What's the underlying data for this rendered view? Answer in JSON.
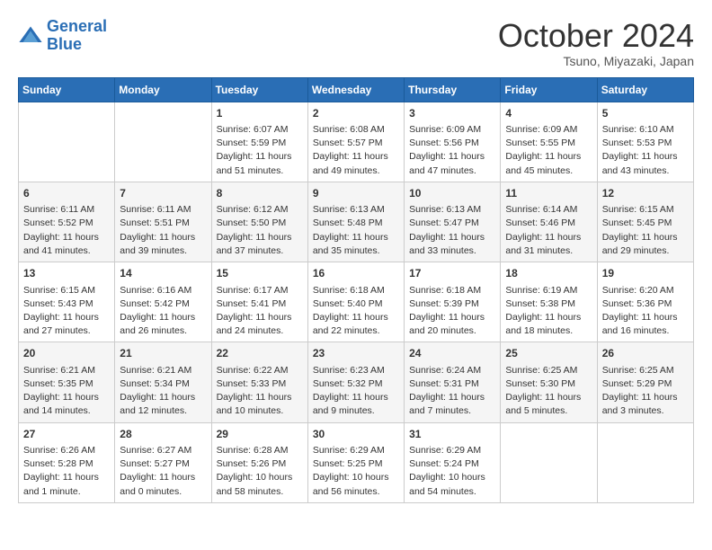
{
  "logo": {
    "line1": "General",
    "line2": "Blue"
  },
  "title": "October 2024",
  "subtitle": "Tsuno, Miyazaki, Japan",
  "days_of_week": [
    "Sunday",
    "Monday",
    "Tuesday",
    "Wednesday",
    "Thursday",
    "Friday",
    "Saturday"
  ],
  "weeks": [
    [
      {
        "day": "",
        "sunrise": "",
        "sunset": "",
        "daylight": ""
      },
      {
        "day": "",
        "sunrise": "",
        "sunset": "",
        "daylight": ""
      },
      {
        "day": "1",
        "sunrise": "Sunrise: 6:07 AM",
        "sunset": "Sunset: 5:59 PM",
        "daylight": "Daylight: 11 hours and 51 minutes."
      },
      {
        "day": "2",
        "sunrise": "Sunrise: 6:08 AM",
        "sunset": "Sunset: 5:57 PM",
        "daylight": "Daylight: 11 hours and 49 minutes."
      },
      {
        "day": "3",
        "sunrise": "Sunrise: 6:09 AM",
        "sunset": "Sunset: 5:56 PM",
        "daylight": "Daylight: 11 hours and 47 minutes."
      },
      {
        "day": "4",
        "sunrise": "Sunrise: 6:09 AM",
        "sunset": "Sunset: 5:55 PM",
        "daylight": "Daylight: 11 hours and 45 minutes."
      },
      {
        "day": "5",
        "sunrise": "Sunrise: 6:10 AM",
        "sunset": "Sunset: 5:53 PM",
        "daylight": "Daylight: 11 hours and 43 minutes."
      }
    ],
    [
      {
        "day": "6",
        "sunrise": "Sunrise: 6:11 AM",
        "sunset": "Sunset: 5:52 PM",
        "daylight": "Daylight: 11 hours and 41 minutes."
      },
      {
        "day": "7",
        "sunrise": "Sunrise: 6:11 AM",
        "sunset": "Sunset: 5:51 PM",
        "daylight": "Daylight: 11 hours and 39 minutes."
      },
      {
        "day": "8",
        "sunrise": "Sunrise: 6:12 AM",
        "sunset": "Sunset: 5:50 PM",
        "daylight": "Daylight: 11 hours and 37 minutes."
      },
      {
        "day": "9",
        "sunrise": "Sunrise: 6:13 AM",
        "sunset": "Sunset: 5:48 PM",
        "daylight": "Daylight: 11 hours and 35 minutes."
      },
      {
        "day": "10",
        "sunrise": "Sunrise: 6:13 AM",
        "sunset": "Sunset: 5:47 PM",
        "daylight": "Daylight: 11 hours and 33 minutes."
      },
      {
        "day": "11",
        "sunrise": "Sunrise: 6:14 AM",
        "sunset": "Sunset: 5:46 PM",
        "daylight": "Daylight: 11 hours and 31 minutes."
      },
      {
        "day": "12",
        "sunrise": "Sunrise: 6:15 AM",
        "sunset": "Sunset: 5:45 PM",
        "daylight": "Daylight: 11 hours and 29 minutes."
      }
    ],
    [
      {
        "day": "13",
        "sunrise": "Sunrise: 6:15 AM",
        "sunset": "Sunset: 5:43 PM",
        "daylight": "Daylight: 11 hours and 27 minutes."
      },
      {
        "day": "14",
        "sunrise": "Sunrise: 6:16 AM",
        "sunset": "Sunset: 5:42 PM",
        "daylight": "Daylight: 11 hours and 26 minutes."
      },
      {
        "day": "15",
        "sunrise": "Sunrise: 6:17 AM",
        "sunset": "Sunset: 5:41 PM",
        "daylight": "Daylight: 11 hours and 24 minutes."
      },
      {
        "day": "16",
        "sunrise": "Sunrise: 6:18 AM",
        "sunset": "Sunset: 5:40 PM",
        "daylight": "Daylight: 11 hours and 22 minutes."
      },
      {
        "day": "17",
        "sunrise": "Sunrise: 6:18 AM",
        "sunset": "Sunset: 5:39 PM",
        "daylight": "Daylight: 11 hours and 20 minutes."
      },
      {
        "day": "18",
        "sunrise": "Sunrise: 6:19 AM",
        "sunset": "Sunset: 5:38 PM",
        "daylight": "Daylight: 11 hours and 18 minutes."
      },
      {
        "day": "19",
        "sunrise": "Sunrise: 6:20 AM",
        "sunset": "Sunset: 5:36 PM",
        "daylight": "Daylight: 11 hours and 16 minutes."
      }
    ],
    [
      {
        "day": "20",
        "sunrise": "Sunrise: 6:21 AM",
        "sunset": "Sunset: 5:35 PM",
        "daylight": "Daylight: 11 hours and 14 minutes."
      },
      {
        "day": "21",
        "sunrise": "Sunrise: 6:21 AM",
        "sunset": "Sunset: 5:34 PM",
        "daylight": "Daylight: 11 hours and 12 minutes."
      },
      {
        "day": "22",
        "sunrise": "Sunrise: 6:22 AM",
        "sunset": "Sunset: 5:33 PM",
        "daylight": "Daylight: 11 hours and 10 minutes."
      },
      {
        "day": "23",
        "sunrise": "Sunrise: 6:23 AM",
        "sunset": "Sunset: 5:32 PM",
        "daylight": "Daylight: 11 hours and 9 minutes."
      },
      {
        "day": "24",
        "sunrise": "Sunrise: 6:24 AM",
        "sunset": "Sunset: 5:31 PM",
        "daylight": "Daylight: 11 hours and 7 minutes."
      },
      {
        "day": "25",
        "sunrise": "Sunrise: 6:25 AM",
        "sunset": "Sunset: 5:30 PM",
        "daylight": "Daylight: 11 hours and 5 minutes."
      },
      {
        "day": "26",
        "sunrise": "Sunrise: 6:25 AM",
        "sunset": "Sunset: 5:29 PM",
        "daylight": "Daylight: 11 hours and 3 minutes."
      }
    ],
    [
      {
        "day": "27",
        "sunrise": "Sunrise: 6:26 AM",
        "sunset": "Sunset: 5:28 PM",
        "daylight": "Daylight: 11 hours and 1 minute."
      },
      {
        "day": "28",
        "sunrise": "Sunrise: 6:27 AM",
        "sunset": "Sunset: 5:27 PM",
        "daylight": "Daylight: 11 hours and 0 minutes."
      },
      {
        "day": "29",
        "sunrise": "Sunrise: 6:28 AM",
        "sunset": "Sunset: 5:26 PM",
        "daylight": "Daylight: 10 hours and 58 minutes."
      },
      {
        "day": "30",
        "sunrise": "Sunrise: 6:29 AM",
        "sunset": "Sunset: 5:25 PM",
        "daylight": "Daylight: 10 hours and 56 minutes."
      },
      {
        "day": "31",
        "sunrise": "Sunrise: 6:29 AM",
        "sunset": "Sunset: 5:24 PM",
        "daylight": "Daylight: 10 hours and 54 minutes."
      },
      {
        "day": "",
        "sunrise": "",
        "sunset": "",
        "daylight": ""
      },
      {
        "day": "",
        "sunrise": "",
        "sunset": "",
        "daylight": ""
      }
    ]
  ]
}
